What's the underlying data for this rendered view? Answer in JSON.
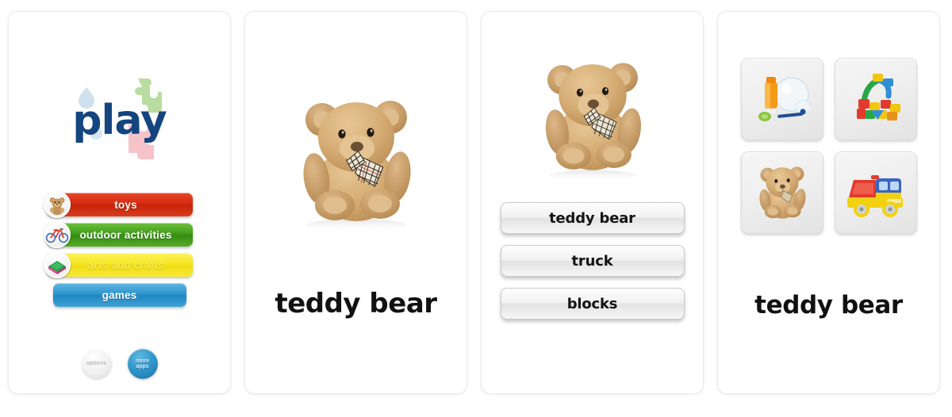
{
  "app": {
    "name": "play",
    "logo_color": "#14457f",
    "puzzle_colors": {
      "green": "#b9dda0",
      "pink": "#f6c3cb",
      "blue": "#cfe0ef"
    }
  },
  "screens": [
    {
      "id": "home",
      "name": "home-menu-screen",
      "menu": [
        {
          "label": "toys",
          "icon": "teddy-bear-icon",
          "color": "#d4290f"
        },
        {
          "label": "outdoor activities",
          "icon": "bicycle-icon",
          "color": "#3f9a1a"
        },
        {
          "label": "arts and crafts",
          "icon": "craft-sponge-icon",
          "color": "#f6e521"
        },
        {
          "label": "games",
          "icon": "none",
          "color": "#2b93cc"
        }
      ],
      "footer_buttons": [
        {
          "label": "options",
          "lines": [
            "options"
          ],
          "style": "light"
        },
        {
          "label": "more apps",
          "lines": [
            "more",
            "apps"
          ],
          "style": "blue"
        }
      ]
    },
    {
      "id": "flashcard",
      "name": "flashcard-screen",
      "image": "teddy-bear-photo",
      "word": "teddy bear"
    },
    {
      "id": "quiz",
      "name": "quiz-screen",
      "image": "teddy-bear-photo",
      "choices": [
        {
          "label": "teddy bear"
        },
        {
          "label": "truck"
        },
        {
          "label": "blocks"
        }
      ]
    },
    {
      "id": "picture-grid",
      "name": "picture-grid-screen",
      "tiles": [
        {
          "label": "bubbles",
          "icon": "bubbles-icon"
        },
        {
          "label": "blocks",
          "icon": "blocks-icon"
        },
        {
          "label": "teddy bear",
          "icon": "teddy-bear-icon"
        },
        {
          "label": "truck",
          "icon": "dump-truck-icon"
        }
      ],
      "word": "teddy bear"
    }
  ]
}
